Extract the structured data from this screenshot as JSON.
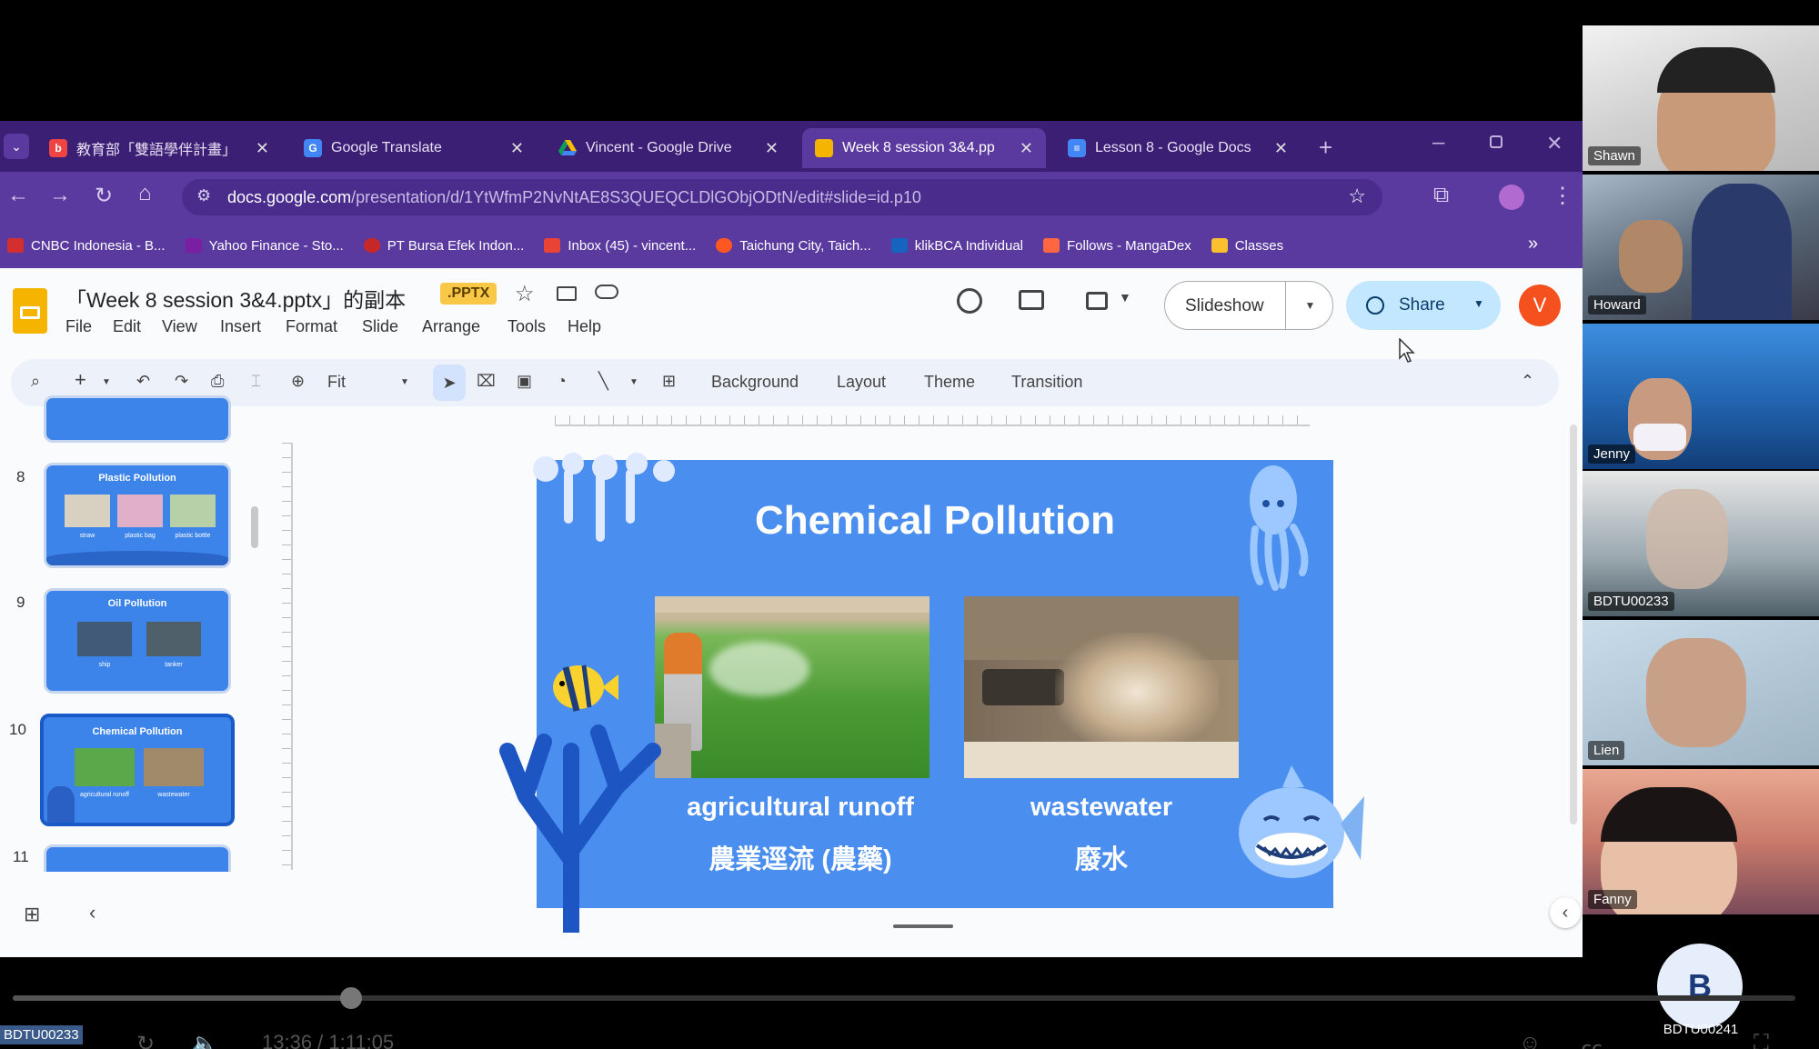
{
  "tabs": [
    {
      "label": "教育部「雙語學伴計畫」",
      "color": "#e44"
    },
    {
      "label": "Google Translate",
      "color": "#4285f4"
    },
    {
      "label": "Vincent - Google Drive",
      "color": "#0f9d58"
    },
    {
      "label": "Week 8 session 3&4.pp",
      "color": "#f4b400"
    },
    {
      "label": "Lesson 8 - Google Docs",
      "color": "#4285f4"
    }
  ],
  "url": {
    "domain": "docs.google.com",
    "path": "/presentation/d/1YtWfmP2NvNtAE8S3QUEQCLDlGObjODtN/edit#slide=id.p10"
  },
  "bookmarks": [
    {
      "label": "CNBC Indonesia - B...",
      "color": "#d32f2f"
    },
    {
      "label": "Yahoo Finance - Sto...",
      "color": "#7b1fa2"
    },
    {
      "label": "PT Bursa Efek Indon...",
      "color": "#c62828"
    },
    {
      "label": "Inbox (45) - vincent...",
      "color": "#ea4335"
    },
    {
      "label": "Taichung City, Taich...",
      "color": "#ff5722"
    },
    {
      "label": "klikBCA Individual",
      "color": "#1565c0"
    },
    {
      "label": "Follows - MangaDex",
      "color": "#ff6740"
    },
    {
      "label": "Classes",
      "color": "#fbc02d"
    }
  ],
  "doc": {
    "title": "「Week 8 session 3&4.pptx」的副本",
    "badge": ".PPTX",
    "menu": [
      "File",
      "Edit",
      "View",
      "Insert",
      "Format",
      "Slide",
      "Arrange",
      "Tools",
      "Help"
    ],
    "slideshow": "Slideshow",
    "share": "Share",
    "avatar": "V",
    "zoom": "Fit",
    "toolbar_buttons": [
      "Background",
      "Layout",
      "Theme",
      "Transition"
    ]
  },
  "thumbnails": [
    {
      "num": "8",
      "title": "Plastic Pollution",
      "captions": [
        "straw",
        "plastic bag",
        "plastic bottle"
      ]
    },
    {
      "num": "9",
      "title": "Oil Pollution",
      "captions": [
        "ship",
        "tanker"
      ]
    },
    {
      "num": "10",
      "title": "Chemical Pollution",
      "captions": [
        "agricultural runoff",
        "wastewater"
      ]
    },
    {
      "num": "11",
      "title": "",
      "captions": []
    }
  ],
  "slide": {
    "title": "Chemical Pollution",
    "left_en": "agricultural runoff",
    "left_zh": "農業逕流 (農藥)",
    "right_en": "wastewater",
    "right_zh": "廢水"
  },
  "participants": [
    {
      "name": "Shawn",
      "bg": "#d9d9d9"
    },
    {
      "name": "Howard",
      "bg": "#6a7a8a"
    },
    {
      "name": "Jenny",
      "bg": "#1f5fa8"
    },
    {
      "name": "BDTU00233",
      "bg": "#8a9aa5"
    },
    {
      "name": "Lien",
      "bg": "#9fb4c4"
    },
    {
      "name": "Fanny",
      "bg": "#c97a6a"
    }
  ],
  "self_tile": {
    "initial": "B",
    "name": "BDTU00241"
  },
  "presenter_label": "BDTU00233",
  "video": {
    "time": "13:36 / 1:11:05",
    "progress": 0.19
  }
}
